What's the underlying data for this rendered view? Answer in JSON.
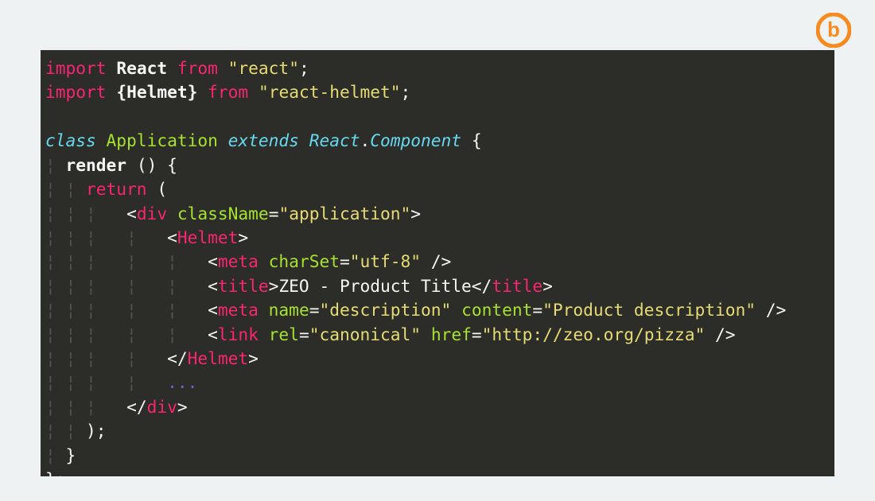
{
  "logo": {
    "letter": "b",
    "color": "#f78b1f"
  },
  "code": {
    "line1": {
      "import": "import",
      "react": "React",
      "from": "from",
      "reactPkg": "\"react\"",
      "semi": ";"
    },
    "line2": {
      "import": "import",
      "helmet": "{Helmet}",
      "from": "from",
      "helmetPkg": "\"react-helmet\"",
      "semi": ";"
    },
    "line4": {
      "classKw": "class",
      "className": "Application",
      "extendsKw": "extends",
      "reactComp": "React",
      "dot": ".",
      "component": "Component",
      "brace": " {"
    },
    "line5": {
      "guide": "¦ ",
      "render": "render",
      "parens": " () {",
      "plainSpace": ""
    },
    "line6": {
      "guide": "¦ ¦ ",
      "returnKw": "return",
      "paren": " ("
    },
    "line7": {
      "guide": "¦ ¦ ¦   ",
      "lt": "<",
      "tag": "div",
      "sp": " ",
      "attr": "className",
      "eq": "=",
      "val": "\"application\"",
      "gt": ">"
    },
    "line8": {
      "guide": "¦ ¦ ¦   ¦   ",
      "lt": "<",
      "tag": "Helmet",
      "gt": ">"
    },
    "line9": {
      "guide": "¦ ¦ ¦   ¦   ¦   ",
      "lt": "<",
      "tag": "meta",
      "sp": " ",
      "attr": "charSet",
      "eq": "=",
      "val": "\"utf-8\"",
      "end": " />"
    },
    "line10": {
      "guide": "¦ ¦ ¦   ¦   ¦   ",
      "lt": "<",
      "tag": "title",
      "gt": ">",
      "text": "ZEO - Product Title",
      "lt2": "</",
      "tag2": "title",
      "gt2": ">"
    },
    "line11": {
      "guide": "¦ ¦ ¦   ¦   ¦   ",
      "lt": "<",
      "tag": "meta",
      "sp": " ",
      "attr1": "name",
      "eq1": "=",
      "val1": "\"description\"",
      "sp2": " ",
      "attr2": "content",
      "eq2": "=",
      "val2": "\"Product description\"",
      "end": " />"
    },
    "line12": {
      "guide": "¦ ¦ ¦   ¦   ¦   ",
      "lt": "<",
      "tag": "link",
      "sp": " ",
      "attr1": "rel",
      "eq1": "=",
      "val1": "\"canonical\"",
      "sp2": " ",
      "attr2": "href",
      "eq2": "=",
      "val2": "\"http://zeo.org/pizza\"",
      "end": " />"
    },
    "line13": {
      "guide": "¦ ¦ ¦   ¦   ",
      "lt": "</",
      "tag": "Helmet",
      "gt": ">"
    },
    "line14": {
      "guide": "¦ ¦ ¦   ¦   ",
      "dots": "..."
    },
    "line15": {
      "guide": "¦ ¦ ¦   ",
      "lt": "</",
      "tag": "div",
      "gt": ">"
    },
    "line16": {
      "guide": "¦ ¦ ",
      "close": ");"
    },
    "line17": {
      "guide": "¦ ",
      "brace": "}"
    },
    "line18": {
      "end": "};"
    }
  }
}
